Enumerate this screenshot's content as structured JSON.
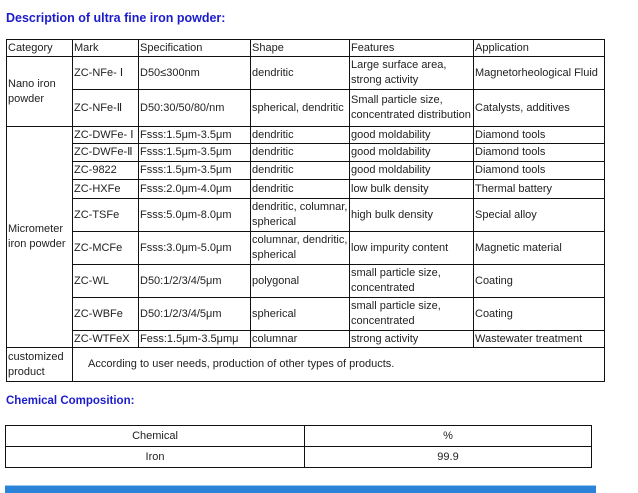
{
  "title": "Description of ultra fine iron powder:",
  "table": {
    "headers": [
      "Category",
      "Mark",
      "Specification",
      "Shape",
      "Features",
      "Application"
    ],
    "categories": {
      "nano": "Nano iron powder",
      "micro": "Micrometer iron powder",
      "custom": "customized product"
    },
    "rows": [
      {
        "mark": "ZC-NFe- Ⅰ",
        "spec": "D50≤300nm",
        "shape": "dendritic",
        "features": "Large surface area, strong activity",
        "application": "Magnetorheological Fluid"
      },
      {
        "mark": "ZC-NFe-Ⅱ",
        "spec": "D50:30/50/80/nm",
        "shape": "spherical, dendritic",
        "features": "Small particle size, concentrated distribution",
        "application": "Catalysts, additives"
      },
      {
        "mark": "ZC-DWFe- Ⅰ",
        "spec": "Fsss:1.5μm-3.5μm",
        "shape": "dendritic",
        "features": "good moldability",
        "application": "Diamond tools"
      },
      {
        "mark": "ZC-DWFe-Ⅱ",
        "spec": "Fsss:1.5μm-3.5μm",
        "shape": "dendritic",
        "features": "good moldability",
        "application": "Diamond tools"
      },
      {
        "mark": "ZC-9822",
        "spec": "Fsss:1.5μm-3.5μm",
        "shape": "dendritic",
        "features": "good moldability",
        "application": "Diamond tools"
      },
      {
        "mark": "ZC-HXFe",
        "spec": "Fsss:2.0μm-4.0μm",
        "shape": "dendritic",
        "features": "low bulk density",
        "application": "Thermal battery"
      },
      {
        "mark": "ZC-TSFe",
        "spec": "Fsss:5.0μm-8.0μm",
        "shape": "dendritic, columnar, spherical",
        "features": "high bulk density",
        "application": "Special alloy"
      },
      {
        "mark": "ZC-MCFe",
        "spec": "Fsss:3.0μm-5.0μm",
        "shape": "columnar, dendritic, spherical",
        "features": "low impurity content",
        "application": "Magnetic material"
      },
      {
        "mark": "ZC-WL",
        "spec": "D50:1/2/3/4/5μm",
        "shape": "polygonal",
        "features": "small particle size, concentrated",
        "application": "Coating"
      },
      {
        "mark": "ZC-WBFe",
        "spec": "D50:1/2/3/4/5μm",
        "shape": "spherical",
        "features": "small particle size, concentrated",
        "application": "Coating"
      },
      {
        "mark": "ZC-WTFeX",
        "spec": "Fess:1.5μm-3.5μmμ",
        "shape": "columnar",
        "features": "strong activity",
        "application": "Wastewater treatment"
      }
    ],
    "custom_text": "According to user needs, production of other types of products."
  },
  "composition": {
    "title": "Chemical Composition:",
    "headers": [
      "Chemical",
      "%"
    ],
    "rows": [
      [
        "Iron",
        "99.9"
      ]
    ]
  }
}
